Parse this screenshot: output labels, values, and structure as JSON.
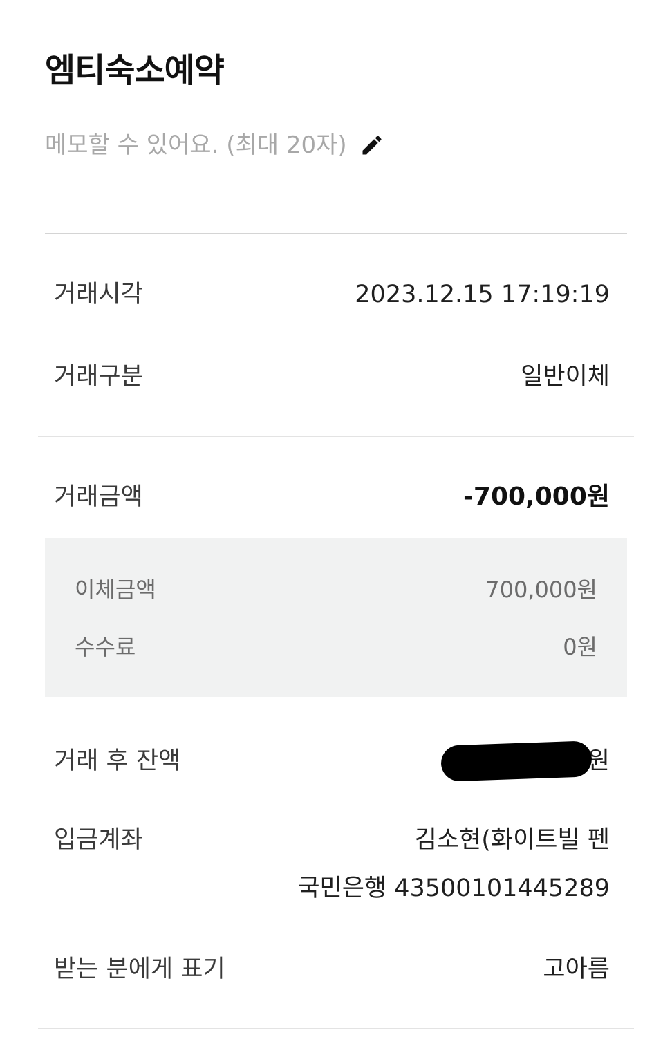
{
  "header": {
    "title": "엠티숙소예약",
    "memo_placeholder": "메모할 수 있어요. (최대 20자)",
    "edit_icon": "pencil-icon"
  },
  "details": {
    "time_label": "거래시각",
    "time_value": "2023.12.15 17:19:19",
    "type_label": "거래구분",
    "type_value": "일반이체",
    "amount_label": "거래금액",
    "amount_value": "-700,000원",
    "transfer_label": "이체금액",
    "transfer_value": "700,000원",
    "fee_label": "수수료",
    "fee_value": "0원",
    "balance_label": "거래 후 잔액",
    "balance_unit": "원",
    "account_label": "입금계좌",
    "account_name": "김소현(화이트빌 펜",
    "account_number": "국민은행 43500101445289",
    "display_label": "받는 분에게 표기",
    "display_value": "고아름"
  },
  "colors": {
    "background": "#ffffff",
    "sub_box": "#f1f2f2",
    "placeholder": "#a8a8a8",
    "divider": "#d4d4d4"
  }
}
